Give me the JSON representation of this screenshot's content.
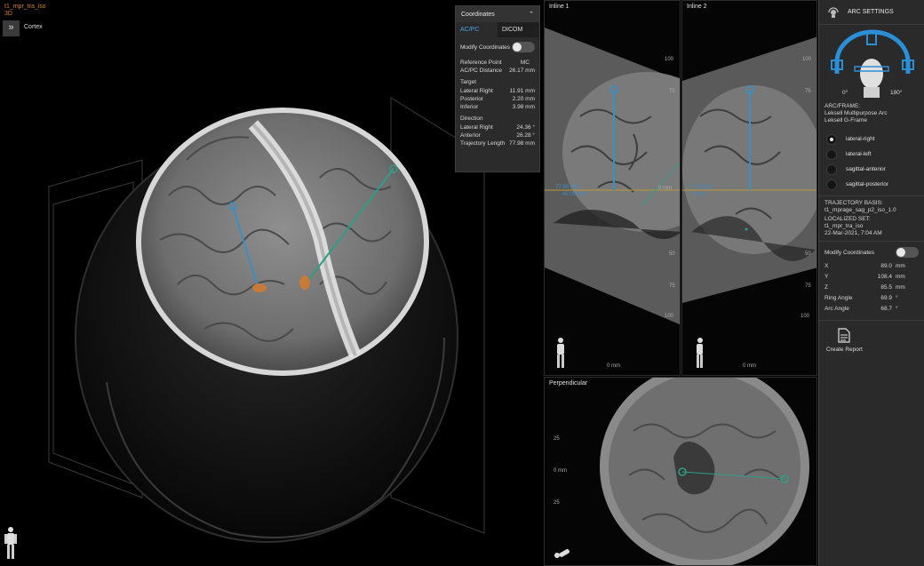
{
  "view3d": {
    "series_name": "t1_mpr_tra_iso",
    "mode": "3D",
    "panel_toggle_icon": "double-chevron-right",
    "render_label": "Cortex"
  },
  "coordinates_panel": {
    "title": "Coordinates",
    "collapse_icon": "chevron-up",
    "tabs": [
      "AC/PC",
      "DICOM"
    ],
    "active_tab": "AC/PC",
    "modify_label": "Modify Coordinates",
    "reference_point_label": "Reference Point",
    "reference_point_value": "MC",
    "acpc_distance_label": "AC/PC Distance",
    "acpc_distance_value": "26.17 mm",
    "target": {
      "title": "Target",
      "rows": [
        {
          "label": "Lateral Right",
          "value": "11.91 mm"
        },
        {
          "label": "Posterior",
          "value": "2.20 mm"
        },
        {
          "label": "Inferior",
          "value": "3.98 mm"
        }
      ]
    },
    "direction": {
      "title": "Direction",
      "rows": [
        {
          "label": "Lateral Right",
          "value": "24.36 °"
        },
        {
          "label": "Anterior",
          "value": "26.28 °"
        },
        {
          "label": "Trajectory Length",
          "value": "77.98 mm"
        }
      ]
    }
  },
  "inline1": {
    "title": "Inline 1",
    "ticks": [
      "100",
      "75",
      "50",
      "25",
      "0 mm",
      "25",
      "50",
      "75",
      "100"
    ],
    "bottom_label": "0 mm",
    "overlay_labels": [
      "77.98 mm",
      "40.00 mm",
      "0 mm"
    ]
  },
  "inline2": {
    "title": "Inline 2",
    "ticks": [
      "100",
      "75",
      "50",
      "25",
      "0 mm",
      "25",
      "50",
      "75",
      "100"
    ],
    "bottom_label": "0 mm",
    "overlay_labels": [
      "77.98 mm",
      "0 mm"
    ]
  },
  "perpendicular": {
    "title": "Perpendicular",
    "ticks": [
      "25",
      "0 mm",
      "25"
    ]
  },
  "arc_settings": {
    "title": "ARC SETTINGS",
    "header_icon": "arc-settings-icon",
    "angle_left": "0°",
    "angle_right": "180°",
    "arc_frame_label": "ARC/FRAME:",
    "arc_name": "Leksell Multipurpose Arc",
    "frame_name": "Leksell G-Frame",
    "orientations": [
      {
        "label": "lateral-right",
        "selected": true
      },
      {
        "label": "lateral-left",
        "selected": false
      },
      {
        "label": "sagittal-anterior",
        "selected": false
      },
      {
        "label": "sagittal-posterior",
        "selected": false
      }
    ],
    "trajectory_basis_label": "TRAJECTORY BASIS:",
    "trajectory_basis_value": "t1_mprage_sag_p2_iso_1.0",
    "localized_set_label": "LOCALIZED SET:",
    "localized_set_value": "t1_mpr_tra_iso",
    "localized_date": "22-Mar-2021, 7:04 AM",
    "modify_label": "Modify Coordinates",
    "values": [
      {
        "label": "X",
        "value": "89.0",
        "unit": "mm"
      },
      {
        "label": "Y",
        "value": "108.4",
        "unit": "mm"
      },
      {
        "label": "Z",
        "value": "85.5",
        "unit": "mm"
      },
      {
        "label": "Ring Angle",
        "value": "69.9",
        "unit": "°"
      },
      {
        "label": "Arc Angle",
        "value": "68.7",
        "unit": "°"
      }
    ],
    "report_label": "Create Report",
    "report_icon": "document-icon"
  },
  "colors": {
    "accent_orange": "#d9822b",
    "trajectory_blue": "#3b8fc4",
    "trajectory_teal": "#2f9e86",
    "tab_active": "#4aa3e0",
    "target_orange": "#c87a3a"
  }
}
